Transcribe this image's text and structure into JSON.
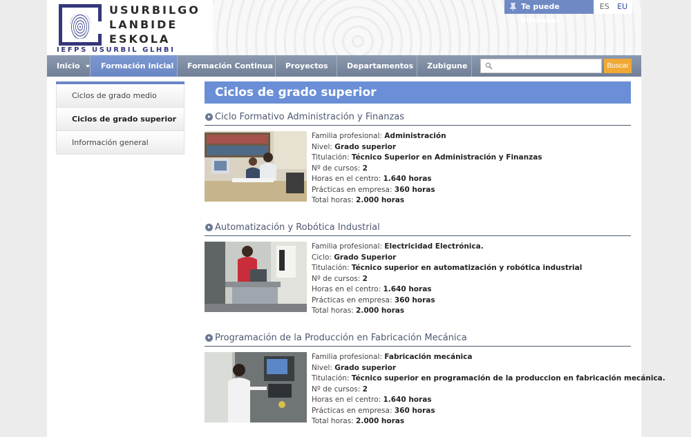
{
  "header": {
    "logo_lines": [
      "USURBILGO",
      "LANBIDE",
      "ESKOLA"
    ],
    "logo_sub": "IEFPS USURBIL GLHBI",
    "interest_label": "Te puede interesar",
    "languages": [
      "ES",
      "EU"
    ],
    "active_language": "EU"
  },
  "nav": {
    "items": [
      {
        "label": "Inicio",
        "has_caret": true,
        "active": false
      },
      {
        "label": "Formación inicial",
        "has_caret": true,
        "active": true
      },
      {
        "label": "Formación Continua",
        "has_caret": true,
        "active": false
      },
      {
        "label": "Proyectos",
        "has_caret": true,
        "active": false
      },
      {
        "label": "Departamentos",
        "has_caret": true,
        "active": false
      },
      {
        "label": "Zubigune",
        "has_caret": false,
        "active": false
      }
    ],
    "search_placeholder": "",
    "search_button": "Buscar"
  },
  "sidebar": {
    "items": [
      {
        "label": "Ciclos de grado medio",
        "bold": false
      },
      {
        "label": "Ciclos de grado superior",
        "bold": true
      },
      {
        "label": "Información general",
        "bold": false
      }
    ]
  },
  "main": {
    "title": "Ciclos de grado superior",
    "courses": [
      {
        "title": "Ciclo Formativo Administración y Finanzas",
        "fields": [
          {
            "label": "Familia profesional:",
            "value": "Administración"
          },
          {
            "label": "Nivel:",
            "value": "Grado superior"
          },
          {
            "label": "Titulación:",
            "value": "Técnico Superior en Administración y Finanzas"
          },
          {
            "label": "Nº de cursos:",
            "value": "2"
          },
          {
            "label": "Horas en el centro:",
            "value": "1.640 horas"
          },
          {
            "label": "Prácticas en empresa:",
            "value": "360 horas"
          },
          {
            "label": "Total horas:",
            "value": "2.000 horas"
          }
        ]
      },
      {
        "title": "Automatización y Robótica Industrial",
        "fields": [
          {
            "label": "Familia profesional:",
            "value": "Electricidad Electrónica."
          },
          {
            "label": "Ciclo:",
            "value": "Grado Superior"
          },
          {
            "label": "Titulación:",
            "value": "Técnico superior en automatización y robótica industrial"
          },
          {
            "label": "Nº de cursos:",
            "value": "2"
          },
          {
            "label": "Horas en el centro:",
            "value": "1.640 horas"
          },
          {
            "label": "Prácticas en empresa:",
            "value": "360 horas"
          },
          {
            "label": "Total horas:",
            "value": "2.000 horas"
          }
        ]
      },
      {
        "title": "Programación de la Producción en Fabricación Mecánica",
        "fields": [
          {
            "label": "Familia profesional:",
            "value": "Fabricación mecánica"
          },
          {
            "label": "Nivel:",
            "value": "Grado superior"
          },
          {
            "label": "Titulación:",
            "value": "Técnico superior en programación de la produccion en fabricación mecánica."
          },
          {
            "label": "Nº de cursos:",
            "value": "2"
          },
          {
            "label": "Horas en el centro:",
            "value": "1.640 horas"
          },
          {
            "label": "Prácticas en empresa:",
            "value": "360 horas"
          },
          {
            "label": "Total horas:",
            "value": "2.000 horas"
          }
        ]
      }
    ]
  },
  "colors": {
    "accent": "#6a8fd6",
    "nav": "#7d8aa1",
    "search_button": "#f0a933",
    "logo": "#34377a"
  }
}
